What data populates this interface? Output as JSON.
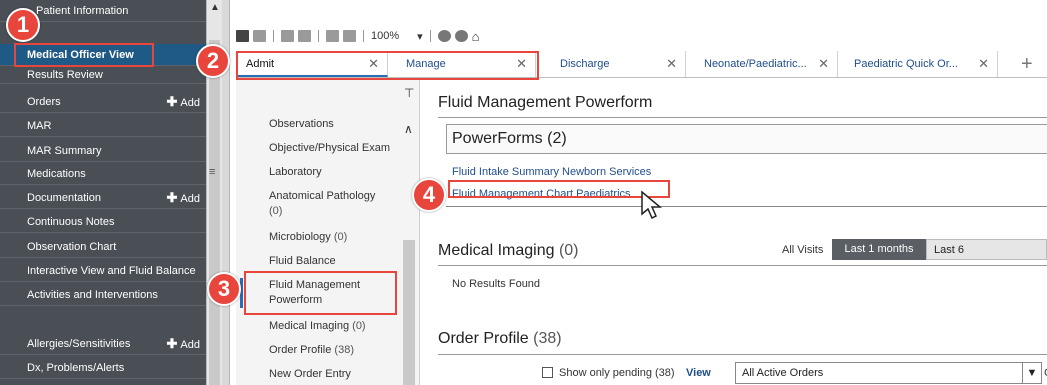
{
  "sidebar": {
    "items": [
      {
        "label": "Patient Information",
        "add": ""
      },
      {
        "label": "Medical Officer View",
        "add": ""
      },
      {
        "label": "Results Review",
        "add": ""
      },
      {
        "label": "Orders",
        "add": "Add"
      },
      {
        "label": "MAR",
        "add": ""
      },
      {
        "label": "MAR Summary",
        "add": ""
      },
      {
        "label": "Medications",
        "add": ""
      },
      {
        "label": "Documentation",
        "add": "Add"
      },
      {
        "label": "Continuous Notes",
        "add": ""
      },
      {
        "label": "Observation Chart",
        "add": ""
      },
      {
        "label": "Interactive View and Fluid Balance",
        "add": ""
      },
      {
        "label": "Activities and Interventions",
        "add": ""
      },
      {
        "label": "Allergies/Sensitivities",
        "add": "Add"
      },
      {
        "label": "Dx, Problems/Alerts",
        "add": ""
      }
    ]
  },
  "toolbar": {
    "zoom": "100%"
  },
  "tabs": [
    {
      "label": "Admit"
    },
    {
      "label": "Manage"
    },
    {
      "label": "Discharge"
    },
    {
      "label": "Neonate/Paediatric..."
    },
    {
      "label": "Paediatric Quick Or..."
    }
  ],
  "navigator": {
    "items": [
      {
        "label": "Observations",
        "count": ""
      },
      {
        "label": "Objective/Physical Exam",
        "count": ""
      },
      {
        "label": "Laboratory",
        "count": ""
      },
      {
        "label": "Anatomical Pathology",
        "count": "(0)"
      },
      {
        "label": "Microbiology",
        "count": "(0)"
      },
      {
        "label": "Fluid Balance",
        "count": ""
      },
      {
        "label": "Fluid Management Powerform",
        "count": ""
      },
      {
        "label": "Medical Imaging",
        "count": "(0)"
      },
      {
        "label": "Order Profile",
        "count": "(38)"
      },
      {
        "label": "New Order Entry",
        "count": ""
      }
    ]
  },
  "content": {
    "fluid_title": "Fluid Management Powerform",
    "powerforms_title": "PowerForms (2)",
    "powerforms": [
      "Fluid Intake Summary Newborn Services",
      "Fluid Management Chart Paediatrics"
    ],
    "imaging_title": "Medical Imaging",
    "imaging_count": "(0)",
    "all_visits": "All Visits",
    "last1": "Last 1 months",
    "last6": "Last 6",
    "no_results": "No Results Found",
    "order_title": "Order Profile",
    "order_count": "(38)",
    "show_pending": "Show only pending (38)",
    "view_label": "View",
    "view_value": "All Active Orders",
    "trailing": "C"
  },
  "callouts": [
    "1",
    "2",
    "3",
    "4"
  ],
  "colors": {
    "callout": "#e8453c",
    "sidebar_bg": "#4a4f55",
    "selected": "#1f5a86",
    "link": "#1f4e8c"
  }
}
